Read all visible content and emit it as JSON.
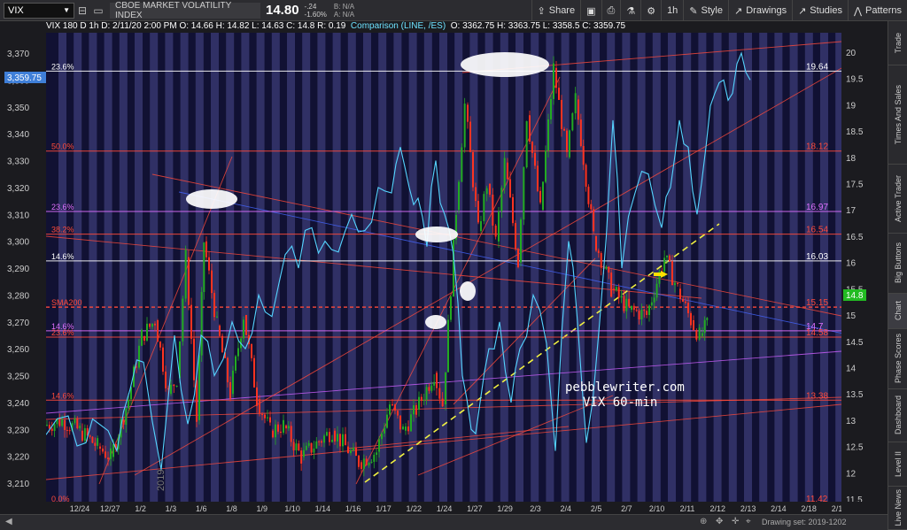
{
  "toolbar": {
    "symbol": "VIX",
    "description": "CBOE MARKET VOLATILITY INDEX",
    "last": "14.80",
    "change": "-.24",
    "change_pct": "-1.60%",
    "bid": "B: N/A",
    "ask": "A: N/A",
    "share_label": "Share",
    "timeframe": "1h",
    "style_label": "Style",
    "drawings_label": "Drawings",
    "studies_label": "Studies",
    "patterns_label": "Patterns"
  },
  "infobar": {
    "ohlc": "VIX 180 D 1h   D: 2/11/20 2:00 PM   O: 14.66   H: 14.82   L: 14.63   C: 14.8   R: 0.19",
    "comparison": "Comparison (LINE, /ES)",
    "cmp_ohlc": "O: 3362.75   H: 3363.75   L: 3358.5   C: 3359.75"
  },
  "left_axis": {
    "ticks": [
      "3,370",
      "3,360",
      "3,350",
      "3,340",
      "3,330",
      "3,320",
      "3,310",
      "3,300",
      "3,290",
      "3,280",
      "3,270",
      "3,260",
      "3,250",
      "3,240",
      "3,230",
      "3,220",
      "3,210"
    ],
    "current": "3,359.75"
  },
  "right_axis": {
    "ticks": [
      "20",
      "19.5",
      "19",
      "18.5",
      "18",
      "17.5",
      "17",
      "16.5",
      "16",
      "15.5",
      "15",
      "14.5",
      "14",
      "13.5",
      "13",
      "12.5",
      "12",
      "11.5"
    ],
    "current": "14.8"
  },
  "time_axis": {
    "labels": [
      "12/24",
      "12/27",
      "1/2",
      "1/3",
      "1/6",
      "1/8",
      "1/9",
      "1/10",
      "1/14",
      "1/16",
      "1/17",
      "1/22",
      "1/24",
      "1/27",
      "1/29",
      "2/3",
      "2/4",
      "2/5",
      "2/7",
      "2/10",
      "2/11",
      "2/12",
      "2/13",
      "2/14",
      "2/18",
      "2/19"
    ]
  },
  "levels": [
    {
      "left": "23.6%",
      "right": "19.64",
      "color": "#ffffff"
    },
    {
      "left": "50.0%",
      "right": "18.12",
      "color": "#ff4a3a"
    },
    {
      "left": "23.6%",
      "right": "16.97",
      "color": "#e070ff"
    },
    {
      "left": "38.2%",
      "right": "16.54",
      "color": "#ff4a3a"
    },
    {
      "left": "14.6%",
      "right": "16.03",
      "color": "#ffffff"
    },
    {
      "left": "SMA200",
      "right": "15.15",
      "color": "#ff4a3a"
    },
    {
      "left": "14.6%",
      "right": "14.7",
      "color": "#e070ff"
    },
    {
      "left": "23.6%",
      "right": "14.58",
      "color": "#ff4a3a"
    },
    {
      "left": "14.6%",
      "right": "13.38",
      "color": "#ff4a3a"
    },
    {
      "left": "0.0%",
      "right": "11.42",
      "color": "#ff4a3a"
    }
  ],
  "annotation": {
    "line1": "pebblewriter.com",
    "line2": "VIX 60-min"
  },
  "watermark": "2019",
  "bottom": {
    "drawing_set": "Drawing set: 2019-1202"
  },
  "side_tabs": [
    "Trade",
    "Times And Sales",
    "Active Trader",
    "Big Buttons",
    "Chart",
    "Phase Scores",
    "Dashboard",
    "Level II",
    "Live News"
  ],
  "colors": {
    "background": "#111133",
    "stripe": "#4a4a8e",
    "candle_up": "#22aa22",
    "candle_down": "#ff3320",
    "comparison_line": "#55d4ff",
    "trend_dashed": "#f0f040"
  }
}
